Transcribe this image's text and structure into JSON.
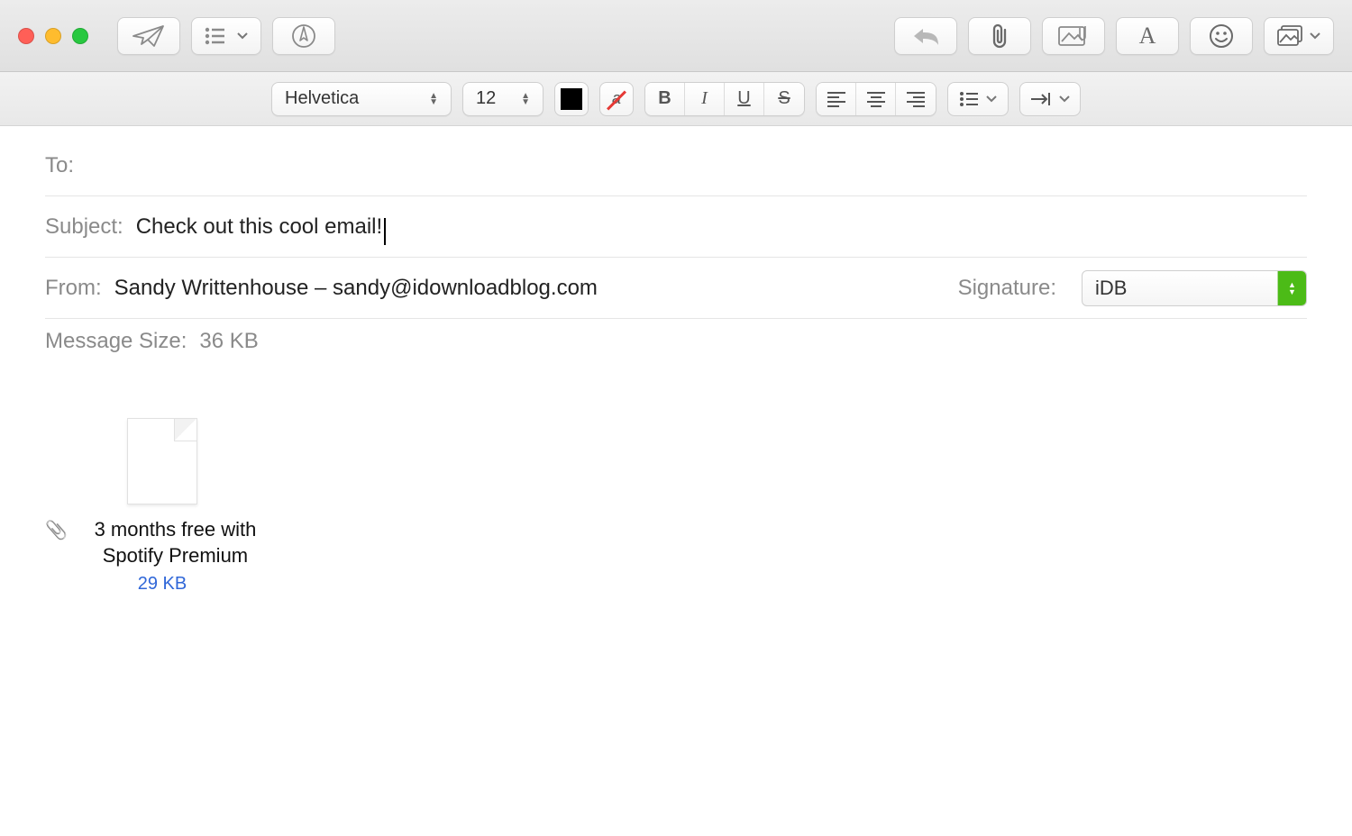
{
  "format": {
    "font": "Helvetica",
    "size": "12"
  },
  "fields": {
    "to_label": "To:",
    "to_value": "",
    "subject_label": "Subject:",
    "subject_value": "Check out this cool email!",
    "from_label": "From:",
    "from_value": "Sandy Writtenhouse – sandy@idownloadblog.com",
    "signature_label": "Signature:",
    "signature_value": "iDB",
    "msgsize_label": "Message Size:",
    "msgsize_value": "36 KB"
  },
  "attachment": {
    "name": "3 months free with Spotify Premium",
    "size": "29 KB"
  }
}
